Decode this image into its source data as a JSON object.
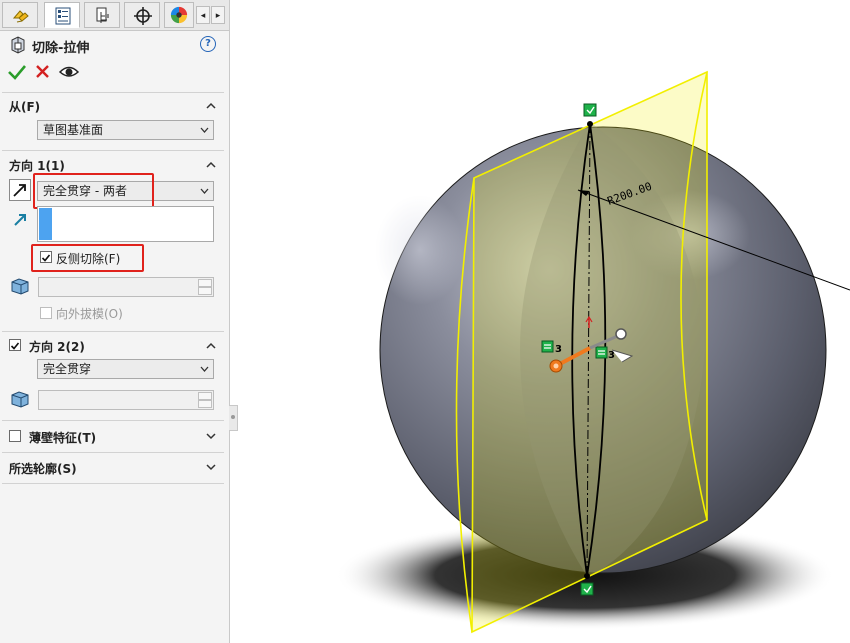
{
  "tabs": [
    {
      "icon": "feature-manager-icon"
    },
    {
      "icon": "property-manager-icon"
    },
    {
      "icon": "configuration-manager-icon"
    },
    {
      "icon": "dimxpert-icon"
    },
    {
      "icon": "display-manager-icon"
    }
  ],
  "tab_scroll": {
    "left": "◂",
    "right": "▸"
  },
  "panel": {
    "title": "切除-拉伸",
    "help": "?",
    "from": {
      "title": "从(F)",
      "value": "草图基准面"
    },
    "direction1": {
      "title": "方向 1(1)",
      "end_condition": "完全贯穿 - 两者",
      "flip_label": "反侧切除(F)",
      "flip_checked": true,
      "draft_outward_label": "向外拔模(O)",
      "draft_outward_checked": false
    },
    "direction2": {
      "title": "方向 2(2)",
      "checked": true,
      "end_condition": "完全贯穿"
    },
    "thin_feature": {
      "title": "薄壁特征(T)",
      "checked": false
    },
    "selected_contours": {
      "title": "所选轮廓(S)"
    }
  },
  "viewport": {
    "dimension_label": "R200.00",
    "relation_badge_1": "3",
    "relation_badge_2": "3",
    "colors": {
      "sketch_plane": "#f2ef00",
      "sphere": "#6f7282",
      "sketch_line": "#000000",
      "handle": "#f07a1e",
      "relation": "#1fb24a"
    }
  },
  "colors": {
    "accept": "#2a9d2a",
    "cancel": "#d32020",
    "highlight": "#e0221c",
    "accent": "#3d9ae8"
  }
}
